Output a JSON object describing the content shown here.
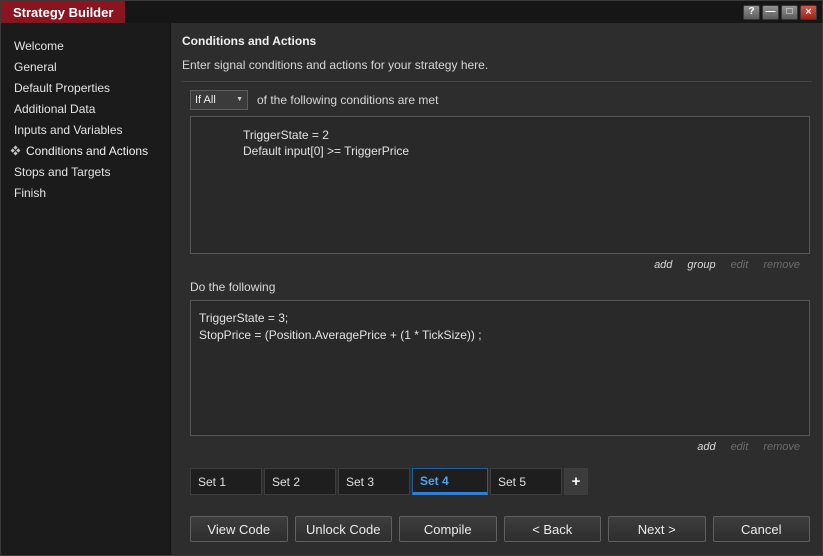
{
  "window": {
    "title": "Strategy Builder",
    "controls": {
      "help": "?",
      "minimize": "—",
      "maximize": "□",
      "close": "×"
    }
  },
  "sidebar": {
    "items": [
      {
        "label": "Welcome"
      },
      {
        "label": "General"
      },
      {
        "label": "Default Properties"
      },
      {
        "label": "Additional Data"
      },
      {
        "label": "Inputs and Variables"
      },
      {
        "label": "Conditions and Actions",
        "selected": true
      },
      {
        "label": "Stops and Targets"
      },
      {
        "label": "Finish"
      }
    ]
  },
  "main": {
    "heading": "Conditions and Actions",
    "description": "Enter signal conditions and actions for your strategy here.",
    "conditions": {
      "mode": "If All",
      "caption": "of the following conditions are met",
      "items": [
        "TriggerState = 2",
        "Default input[0] >= TriggerPrice"
      ],
      "links": [
        {
          "label": "add",
          "enabled": true
        },
        {
          "label": "group",
          "enabled": true
        },
        {
          "label": "edit",
          "enabled": false
        },
        {
          "label": "remove",
          "enabled": false
        }
      ]
    },
    "actions": {
      "label": "Do the following",
      "items": [
        "TriggerState = 3;",
        "StopPrice = (Position.AveragePrice + (1 * TickSize)) ;"
      ],
      "links": [
        {
          "label": "add",
          "enabled": true
        },
        {
          "label": "edit",
          "enabled": false
        },
        {
          "label": "remove",
          "enabled": false
        }
      ]
    },
    "sets": {
      "tabs": [
        {
          "label": "Set 1"
        },
        {
          "label": "Set 2"
        },
        {
          "label": "Set 3"
        },
        {
          "label": "Set 4",
          "active": true
        },
        {
          "label": "Set 5"
        }
      ],
      "add_tab": "+"
    }
  },
  "footer": {
    "buttons": [
      "View Code",
      "Unlock Code",
      "Compile",
      "< Back",
      "Next >",
      "Cancel"
    ]
  },
  "colors": {
    "titlebar_red": "#8a1520",
    "active_tab_blue": "#4da3f5",
    "close_button_red": "#b03225"
  }
}
